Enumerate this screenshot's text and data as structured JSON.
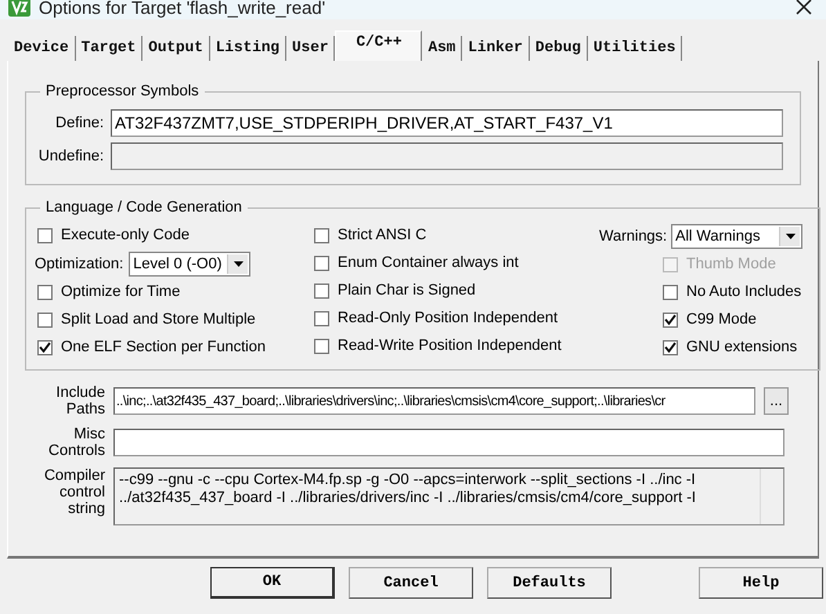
{
  "window": {
    "title": "Options for Target 'flash_write_read'"
  },
  "tabs": [
    {
      "label": "Device",
      "selected": false
    },
    {
      "label": "Target",
      "selected": false
    },
    {
      "label": "Output",
      "selected": false
    },
    {
      "label": "Listing",
      "selected": false
    },
    {
      "label": "User",
      "selected": false
    },
    {
      "label": "C/C++",
      "selected": true
    },
    {
      "label": "Asm",
      "selected": false
    },
    {
      "label": "Linker",
      "selected": false
    },
    {
      "label": "Debug",
      "selected": false
    },
    {
      "label": "Utilities",
      "selected": false
    }
  ],
  "preprocessor": {
    "title": "Preprocessor Symbols",
    "define_label": "Define:",
    "define_value": "AT32F437ZMT7,USE_STDPERIPH_DRIVER,AT_START_F437_V1",
    "undefine_label": "Undefine:",
    "undefine_disabled": true
  },
  "language": {
    "title": "Language / Code Generation",
    "columns": [
      {
        "items": [
          {
            "kind": "checkbox",
            "label": "Execute-only Code",
            "checked": false,
            "disabled": false
          },
          {
            "kind": "select",
            "label": "Optimization:",
            "value": "Level 0 (-O0)"
          },
          {
            "kind": "checkbox",
            "label": "Optimize for Time",
            "checked": false,
            "disabled": false
          },
          {
            "kind": "checkbox",
            "label": "Split Load and Store Multiple",
            "checked": false,
            "disabled": false
          },
          {
            "kind": "checkbox",
            "label": "One ELF Section per Function",
            "checked": true,
            "disabled": false
          }
        ]
      },
      {
        "items": [
          {
            "kind": "checkbox",
            "label": "Strict ANSI C",
            "checked": false,
            "disabled": false
          },
          {
            "kind": "checkbox",
            "label": "Enum Container always int",
            "checked": false,
            "disabled": false
          },
          {
            "kind": "checkbox",
            "label": "Plain Char is Signed",
            "checked": false,
            "disabled": false
          },
          {
            "kind": "checkbox",
            "label": "Read-Only Position Independent",
            "checked": false,
            "disabled": false
          },
          {
            "kind": "checkbox",
            "label": "Read-Write Position Independent",
            "checked": false,
            "disabled": false
          }
        ]
      },
      {
        "items": [
          {
            "kind": "select",
            "label": "Warnings:",
            "value": "All Warnings"
          },
          {
            "kind": "checkbox",
            "label": "Thumb Mode",
            "checked": false,
            "disabled": true
          },
          {
            "kind": "checkbox",
            "label": "No Auto Includes",
            "checked": false,
            "disabled": false
          },
          {
            "kind": "checkbox",
            "label": "C99 Mode",
            "checked": true,
            "disabled": false
          },
          {
            "kind": "checkbox",
            "label": "GNU extensions",
            "checked": true,
            "disabled": false
          }
        ]
      }
    ]
  },
  "include": {
    "label_lines": [
      "Include",
      "Paths"
    ],
    "value": "..\\inc;..\\at32f435_437_board;..\\libraries\\drivers\\inc;..\\libraries\\cmsis\\cm4\\core_support;..\\libraries\\cr",
    "browse": "..."
  },
  "misc": {
    "label_lines": [
      "Misc",
      "Controls"
    ]
  },
  "compiler": {
    "label_lines": [
      "Compiler",
      "control",
      "string"
    ],
    "lines": [
      "--c99 --gnu -c --cpu Cortex-M4.fp.sp -g -O0 --apcs=interwork --split_sections -I ../inc -I",
      "../at32f435_437_board -I ../libraries/drivers/inc -I ../libraries/cmsis/cm4/core_support -I"
    ]
  },
  "buttons": [
    {
      "label": "OK",
      "kind": "default"
    },
    {
      "label": "Cancel",
      "kind": "normal"
    },
    {
      "label": "Defaults",
      "kind": "normal"
    },
    {
      "label": "Help",
      "kind": "help"
    }
  ]
}
